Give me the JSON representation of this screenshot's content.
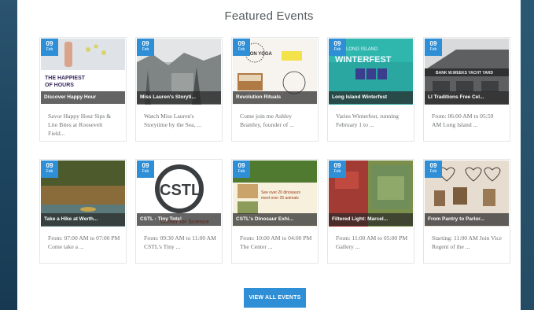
{
  "section": {
    "title": "Featured Events",
    "button_label": "VIEW ALL EVENTS"
  },
  "colors": {
    "accent": "#2f8fd6",
    "date_badge": "#2f8fd6",
    "caption_overlay": "#333333"
  },
  "events": [
    {
      "day": "09",
      "month": "Feb",
      "title": "Discover Happy Hour",
      "poster_text": "THE HAPPIEST OF HOURS",
      "desc": "Savor Happy Hour Sips & Lite Bites at Roosevelt Field..."
    },
    {
      "day": "09",
      "month": "Feb",
      "title": "Miss Lauren's Storyti...",
      "desc": "Watch Miss Lauren's Storytime by the Sea, ..."
    },
    {
      "day": "09",
      "month": "Feb",
      "title": "Revolution Rituals",
      "poster_text": "ION YOGA",
      "desc": "Come join me Ashley Brantley, founder of ..."
    },
    {
      "day": "09",
      "month": "Feb",
      "title": "Long Island Winterfest",
      "poster_text": "LONG ISLAND WINTERFEST",
      "desc": "Varies Winterfest, running February 1 to ..."
    },
    {
      "day": "09",
      "month": "Feb",
      "title": "LI Traditions Free Cel...",
      "poster_text": "BANK W.WEEKS YACHT YARD",
      "desc": "From: 06:00 AM to 05:59 AM Long Island ..."
    },
    {
      "day": "09",
      "month": "Feb",
      "title": "Take a Hike at Werth...",
      "desc": "From: 07:00 AM to 07:00 PM Come take a ..."
    },
    {
      "day": "09",
      "month": "Feb",
      "title": "CSTL - Tiny Tots!",
      "poster_text": "CSTL",
      "poster_subtext": "Center for Science",
      "desc": "From: 09:30 AM to 11:00 AM CSTL's Tiny ..."
    },
    {
      "day": "09",
      "month": "Feb",
      "title": "CSTL's Dinosaur Exhi...",
      "poster_text": "See over 20 dinosaurs, meet over 25 animals from snakes to emus",
      "desc": "From: 10:00 AM to 04:00 PM The Center ..."
    },
    {
      "day": "09",
      "month": "Feb",
      "title": "Filtered Light: Marcel...",
      "desc": "From: 11:00 AM to 05:00 PM Gallery ..."
    },
    {
      "day": "09",
      "month": "Feb",
      "title": "From Pantry to Parlor...",
      "desc": "Starting: 11:00 AM Join Vice Regent of the ..."
    }
  ]
}
